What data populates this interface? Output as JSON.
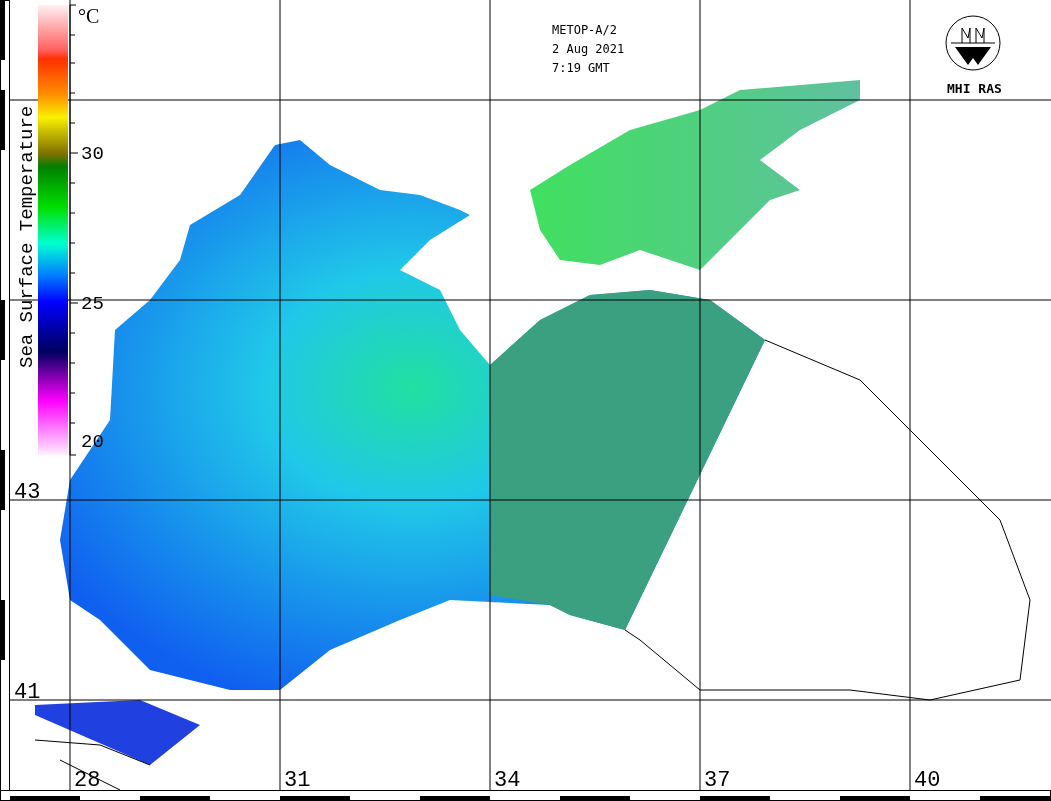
{
  "colorbar": {
    "unit": "°C",
    "title": "Sea Surface Temperature",
    "ticks": [
      "30",
      "25",
      "20"
    ]
  },
  "satellite": {
    "lines": [
      "METOP-A/2",
      "2 Aug 2021",
      "7:19 GMT"
    ]
  },
  "logo": {
    "label": "MHI RAS"
  },
  "map": {
    "latitude_labels": [
      "43",
      "41"
    ],
    "longitude_labels": [
      "28",
      "31",
      "34",
      "37",
      "40"
    ]
  }
}
